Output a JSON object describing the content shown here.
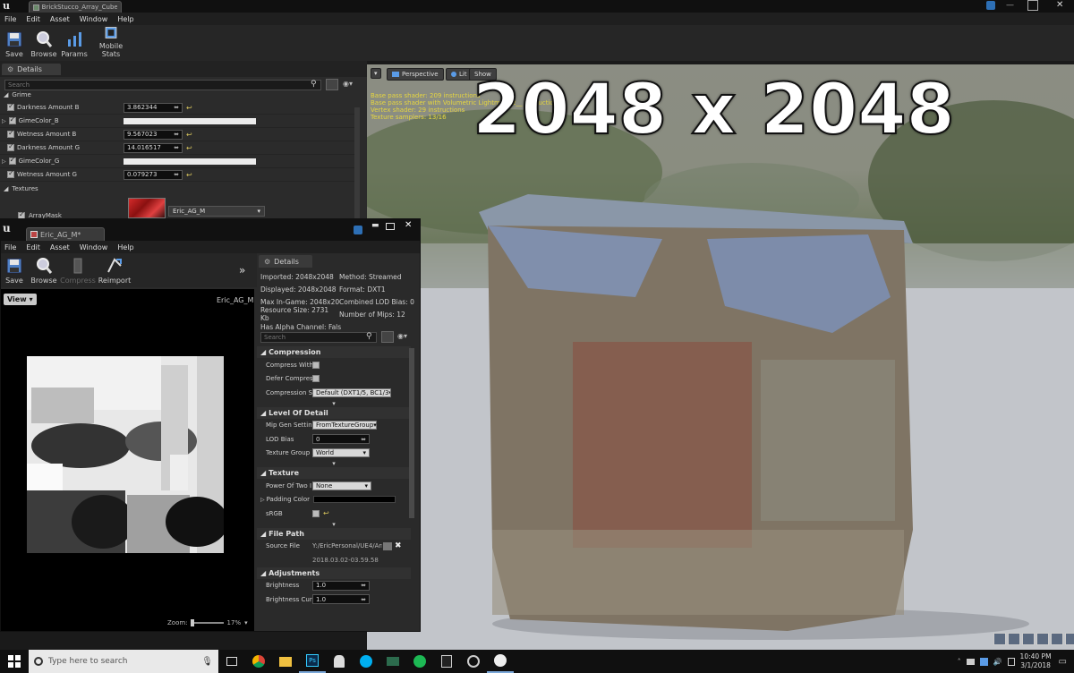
{
  "main_window": {
    "tab_label": "BrickStucco_Array_Cube_I",
    "menu": [
      "File",
      "Edit",
      "Asset",
      "Window",
      "Help"
    ],
    "toolbar": [
      {
        "label": "Save",
        "icon": "save-icon"
      },
      {
        "label": "Browse",
        "icon": "browse-icon"
      },
      {
        "label": "Params",
        "icon": "params-icon"
      },
      {
        "label": "Mobile Stats",
        "icon": "mobile-stats-icon"
      }
    ]
  },
  "material_details": {
    "tab_label": "Details",
    "search_placeholder": "Search",
    "group_grime": "Grime",
    "rows": [
      {
        "label": "Darkness Amount B",
        "type": "number",
        "value": "3.862344"
      },
      {
        "label": "GimeColor_B",
        "type": "color"
      },
      {
        "label": "Wetness Amount B",
        "type": "number",
        "value": "9.567023"
      },
      {
        "label": "Darkness Amount G",
        "type": "number",
        "value": "14.016517"
      },
      {
        "label": "GimeColor_G",
        "type": "color"
      },
      {
        "label": "Wetness Amount G",
        "type": "number",
        "value": "0.079273"
      }
    ],
    "group_textures": "Textures",
    "array_mask_label": "ArrayMask",
    "array_mask_value": "Eric_AG_M"
  },
  "viewport": {
    "buttons": [
      "Perspective",
      "Lit",
      "Show"
    ],
    "stats": [
      "Base pass shader: 209 instructions",
      "Base pass shader with Volumetric Lightmap: 2__ instructions",
      "Vertex shader: 29 instructions",
      "Texture samplers: 13/16"
    ],
    "overlay_text": "2048 x 2048"
  },
  "texture_window": {
    "tab_label": "Eric_AG_M*",
    "menu": [
      "File",
      "Edit",
      "Asset",
      "Window",
      "Help"
    ],
    "toolbar": [
      {
        "label": "Save",
        "icon": "save-icon"
      },
      {
        "label": "Browse",
        "icon": "browse-icon"
      },
      {
        "label": "Compress",
        "icon": "compress-icon"
      },
      {
        "label": "Reimport",
        "icon": "reimport-icon"
      }
    ],
    "view_button": "View",
    "asset_name": "Eric_AG_M",
    "zoom_label": "Zoom:",
    "zoom_value": "17%",
    "details_tab": "Details",
    "info": {
      "imported": "Imported: 2048x2048",
      "method": "Method: Streamed",
      "displayed": "Displayed: 2048x2048",
      "format": "Format: DXT1",
      "max_ingame": "Max In-Game: 2048x204",
      "combined_lod": "Combined LOD Bias: 0",
      "resource_size": "Resource Size: 2731 Kb",
      "mips": "Number of Mips: 12",
      "alpha": "Has Alpha Channel: Fals"
    },
    "search_placeholder": "Search",
    "sections": {
      "compression": {
        "title": "Compression",
        "compress_without_alpha": "Compress With",
        "defer_compression": "Defer Compres",
        "settings_label": "Compression S",
        "settings_value": "Default (DXT1/5, BC1/3"
      },
      "lod": {
        "title": "Level Of Detail",
        "mip_gen_label": "Mip Gen Settin",
        "mip_gen_value": "FromTextureGroup",
        "lod_bias_label": "LOD Bias",
        "lod_bias_value": "0",
        "group_label": "Texture Group",
        "group_value": "World"
      },
      "texture": {
        "title": "Texture",
        "pow2_label": "Power Of Two I",
        "pow2_value": "None",
        "padding_label": "Padding Color",
        "srgb_label": "sRGB"
      },
      "file_path": {
        "title": "File Path",
        "source_label": "Source File",
        "source_value": "Y:/EricPersonal/UE4/Arr",
        "timestamp": "2018.03.02-03.59.58"
      },
      "adjustments": {
        "title": "Adjustments",
        "brightness_label": "Brightness",
        "brightness_value": "1.0",
        "brightness_curve_label": "Brightness Cur",
        "brightness_curve_value": "1.0"
      }
    }
  },
  "taskbar": {
    "search_placeholder": "Type here to search",
    "time": "10:40 PM",
    "date": "3/1/2018"
  },
  "colors": {
    "accent_blue": "#2d6fb5",
    "reset_arrow": "#d6c35c",
    "stat_yellow": "#e6d640"
  }
}
